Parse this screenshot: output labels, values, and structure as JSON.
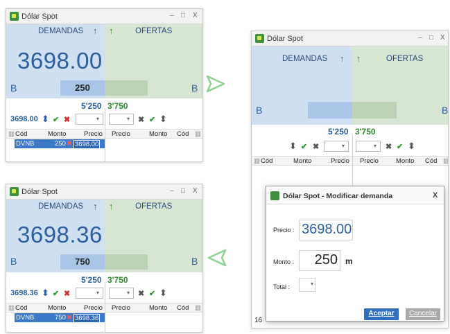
{
  "window_title": "Dólar Spot",
  "min_glyph": "–",
  "max_glyph": "□",
  "close_glyph": "X",
  "demandas": "DEMANDAS",
  "ofertas": "OFERTAS",
  "arrow_up": "↑",
  "side_b": "B",
  "tot_dem": "5'250",
  "tot_ofr": "3'750",
  "spin": "⬍",
  "check": "✔",
  "cross": "✖",
  "dd": "▾",
  "cols": {
    "cod": "Cód",
    "monto": "Monto",
    "precio": "Precio"
  },
  "grid_icon": "▥",
  "w1": {
    "price": "3698.00",
    "monto": "250",
    "ctrl_price": "3698.00",
    "row": {
      "cod": "DVNB",
      "monto": "250",
      "precio": "3698.00"
    }
  },
  "w3": {
    "price": "3698.36",
    "monto": "750",
    "ctrl_price": "3698.36",
    "row": {
      "cod": "DVNB",
      "monto": "750",
      "precio": "3698.36"
    }
  },
  "dialog": {
    "title": "Dólar Spot - Modificar demanda",
    "close": "X",
    "precio_label": "Precio :",
    "precio_value": "3698.00",
    "monto_label": "Monto :",
    "monto_value": "250",
    "monto_unit": "m",
    "total_label": "Total :",
    "accept": "Aceptar",
    "cancel": "Cancelar",
    "peek": "16"
  },
  "colors": {
    "demand_bg": "#cfe0f3",
    "offer_bg": "#d6e6d2",
    "price_blue": "#2b5e9c",
    "row_blue": "#3b78c8",
    "arrow_green": "#8fd18f"
  }
}
